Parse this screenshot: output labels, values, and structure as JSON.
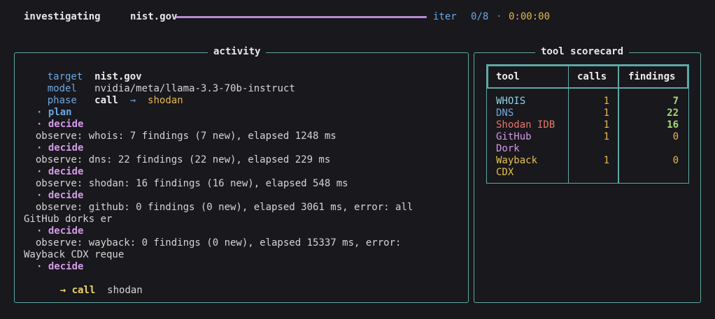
{
  "topbar": {
    "glyph": "",
    "title": "investigating",
    "target": "nist.gov",
    "progress_fraction": 0,
    "iter_label": "iter",
    "iter_value": "0/8",
    "separator": "·",
    "elapsed": "0:00:00"
  },
  "activity": {
    "title": "activity",
    "target_key": "target",
    "target_val": "nist.gov",
    "model_key": "model",
    "model_val": "nvidia/meta/llama-3.3-70b-instruct",
    "phase_key": "phase",
    "phase_val": "call",
    "phase_arrow": "→",
    "phase_arg": "shodan",
    "log": [
      {
        "kind": "plan",
        "text": "· plan"
      },
      {
        "kind": "decide",
        "text": "· decide"
      },
      {
        "kind": "obs",
        "text": "  observe: whois: 7 findings (7 new), elapsed 1248 ms"
      },
      {
        "kind": "decide",
        "text": "· decide"
      },
      {
        "kind": "obs",
        "text": "  observe: dns: 22 findings (22 new), elapsed 229 ms"
      },
      {
        "kind": "decide",
        "text": "· decide"
      },
      {
        "kind": "obs",
        "text": "  observe: shodan: 16 findings (16 new), elapsed 548 ms"
      },
      {
        "kind": "decide",
        "text": "· decide"
      },
      {
        "kind": "obs",
        "text": "  observe: github: 0 findings (0 new), elapsed 3061 ms, error: all"
      },
      {
        "kind": "wrap",
        "text": "GitHub dorks er"
      },
      {
        "kind": "decide",
        "text": "· decide"
      },
      {
        "kind": "obs",
        "text": "  observe: wayback: 0 findings (0 new), elapsed 15337 ms, error:"
      },
      {
        "kind": "wrap",
        "text": "Wayback CDX reque"
      },
      {
        "kind": "decide",
        "text": "· decide"
      }
    ],
    "call_label": "→ call",
    "call_arg": "shodan"
  },
  "scorecard": {
    "title": "tool scorecard",
    "headers": [
      "tool",
      "calls",
      "findings"
    ],
    "rows": [
      {
        "tool": [
          "WHOIS"
        ],
        "calls": "1",
        "findings": "7",
        "tool_color": "#8fd3e6",
        "findings_color": "#a9d97a"
      },
      {
        "tool": [
          "DNS"
        ],
        "calls": "1",
        "findings": "22",
        "tool_color": "#6ea8e0",
        "findings_color": "#a9d97a"
      },
      {
        "tool": [
          "Shodan IDB"
        ],
        "calls": "1",
        "findings": "16",
        "tool_color": "#e8776a",
        "findings_color": "#a9d97a"
      },
      {
        "tool": [
          "GitHub",
          "Dork"
        ],
        "calls": "1",
        "findings": "0",
        "tool_color": "#d39ae6",
        "findings_color": "#e7b84e"
      },
      {
        "tool": [
          "Wayback",
          "CDX"
        ],
        "calls": "1",
        "findings": "0",
        "tool_color": "#e7c24e",
        "findings_color": "#e7b84e"
      }
    ],
    "calls_color": "#e7b84e"
  },
  "colors": {
    "background": "#18181d",
    "border": "#5fa9a4",
    "accent_blue": "#6ea8e0",
    "accent_purple": "#d39ae6",
    "accent_yellow": "#e7b84e",
    "progress": "#b98ad8"
  }
}
